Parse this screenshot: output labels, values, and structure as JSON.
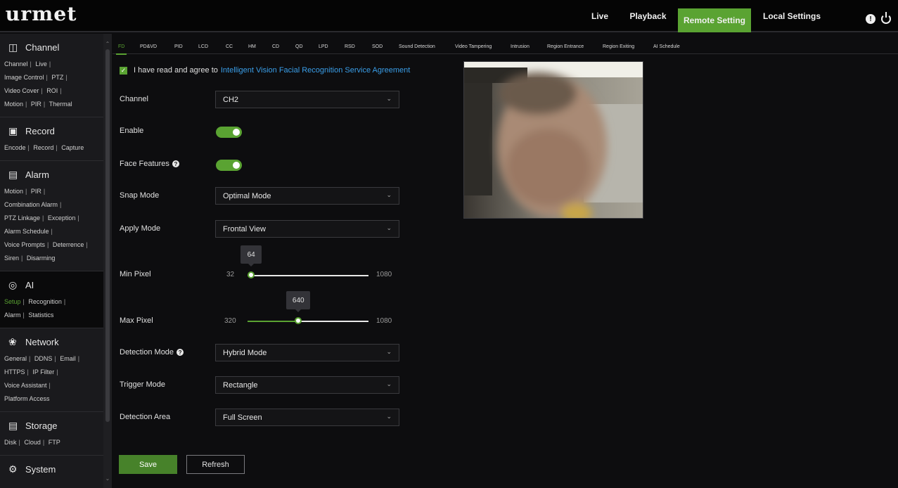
{
  "brand": {
    "logo": "urmet"
  },
  "topnav": {
    "live": "Live",
    "playback": "Playback",
    "remote_setting": "Remote Setting",
    "local_settings": "Local Settings",
    "info_icon": "info-icon",
    "power_icon": "power-icon"
  },
  "colors": {
    "accent": "#5aa332",
    "link": "#3a9ee8",
    "background": "#0d0d0f",
    "sidebar": "#1a1a1d"
  },
  "sidebar": {
    "channel": {
      "title": "Channel",
      "links": [
        "Channel",
        "Live",
        "Image Control",
        "PTZ",
        "Video Cover",
        "ROI",
        "Motion",
        "PIR",
        "Thermal"
      ]
    },
    "record": {
      "title": "Record",
      "links": [
        "Encode",
        "Record",
        "Capture"
      ]
    },
    "alarm": {
      "title": "Alarm",
      "links": [
        "Motion",
        "PIR",
        "Combination Alarm",
        "PTZ Linkage",
        "Exception",
        "Alarm Schedule",
        "Voice Prompts",
        "Deterrence",
        "Siren",
        "Disarming"
      ]
    },
    "ai": {
      "title": "AI",
      "links": [
        "Setup",
        "Recognition",
        "Alarm",
        "Statistics"
      ],
      "selected": "Setup"
    },
    "network": {
      "title": "Network",
      "links": [
        "General",
        "DDNS",
        "Email",
        "HTTPS",
        "IP Filter",
        "Voice Assistant",
        "Platform Access"
      ]
    },
    "storage": {
      "title": "Storage",
      "links": [
        "Disk",
        "Cloud",
        "FTP"
      ]
    },
    "system": {
      "title": "System"
    }
  },
  "tabs": [
    "FD",
    "PD&VD",
    "PID",
    "LCD",
    "CC",
    "HM",
    "CD",
    "QD",
    "LPD",
    "RSD",
    "SOD",
    "Sound Detection",
    "Video Tampering",
    "Intrusion",
    "Region Entrance",
    "Region Exiting",
    "AI Schedule"
  ],
  "active_tab": "FD",
  "agreement": {
    "checked": true,
    "text": "I have read and agree to",
    "link": "Intelligent Vision Facial Recognition Service Agreement"
  },
  "form": {
    "channel": {
      "label": "Channel",
      "value": "CH2"
    },
    "enable": {
      "label": "Enable",
      "on": true
    },
    "face_features": {
      "label": "Face Features",
      "on": true
    },
    "snap_mode": {
      "label": "Snap Mode",
      "value": "Optimal Mode"
    },
    "apply_mode": {
      "label": "Apply Mode",
      "value": "Frontal View"
    },
    "min_pixel": {
      "label": "Min Pixel",
      "min": "32",
      "max": "1080",
      "value": "64",
      "fraction": 0.03
    },
    "max_pixel": {
      "label": "Max Pixel",
      "min": "320",
      "max": "1080",
      "value": "640",
      "fraction": 0.42
    },
    "detection_mode": {
      "label": "Detection Mode",
      "value": "Hybrid Mode"
    },
    "trigger_mode": {
      "label": "Trigger Mode",
      "value": "Rectangle"
    },
    "detection_area": {
      "label": "Detection Area",
      "value": "Full Screen"
    }
  },
  "buttons": {
    "save": "Save",
    "refresh": "Refresh"
  }
}
